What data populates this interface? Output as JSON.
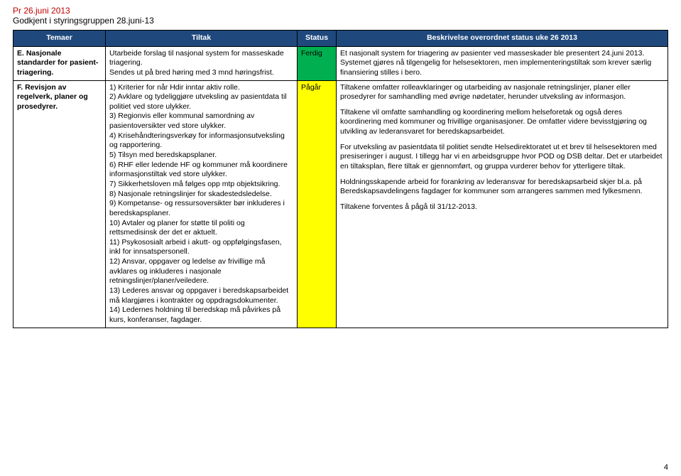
{
  "header": {
    "line1": "Pr 26.juni 2013",
    "line2": "Godkjent i styringsgruppen 28.juni-13"
  },
  "columns": {
    "temaer": "Temaer",
    "tiltak": "Tiltak",
    "status": "Status",
    "beskriv": "Beskrivelse overordnet status uke 26 2013"
  },
  "rows": [
    {
      "tema": "E. Nasjonale standarder for pasient-triagering.",
      "tiltak": "Utarbeide forslag til nasjonal system for masseskade triagering.\nSendes ut på bred høring med 3 mnd høringsfrist.",
      "status": "Ferdig",
      "status_class": "status-green",
      "beskriv_paras": [
        "Et nasjonalt system for triagering av pasienter ved masseskader ble presentert 24.juni 2013. Systemet gjøres nå tilgengelig for helsesektoren, men implementeringstiltak som krever særlig finansiering stilles i bero."
      ]
    },
    {
      "tema": "F. Revisjon av regelverk, planer og prosedyrer.",
      "tiltak": "1) Kriterier for når Hdir inntar aktiv rolle.\n2) Avklare og tydeliggjøre utveksling av pasientdata til politiet ved store ulykker.\n3) Regionvis eller kommunal samordning av pasientoversikter ved store ulykker.\n4) Krisehåndteringsverkøy for informasjonsutveksling og rapportering.\n5) Tilsyn med beredskapsplaner.\n6) RHF eller ledende HF og kommuner må koordinere informasjonstiltak ved store ulykker.\n7) Sikkerhetsloven må følges opp mtp objektsikring.\n8) Nasjonale retningslinjer for skadestedsledelse.\n9) Kompetanse- og ressursoversikter bør inkluderes i beredskapsplaner.\n10) Avtaler og planer for støtte til politi og rettsmedisinsk der det er aktuelt.\n11) Psykososialt arbeid i akutt- og oppfølgingsfasen, inkl for innsatspersonell.\n12) Ansvar, oppgaver og ledelse av frivillige må avklares og inkluderes i nasjonale retningslinjer/planer/veiledere.\n13) Lederes ansvar og oppgaver i beredskapsarbeidet må klargjøres i kontrakter og oppdragsdokumenter.\n14) Ledernes holdning til beredskap må påvirkes på kurs, konferanser, fagdager.",
      "status": "Pågår",
      "status_class": "status-yellow",
      "beskriv_paras": [
        "Tiltakene omfatter rolleavklaringer og utarbeiding av nasjonale retningslinjer, planer eller prosedyrer for samhandling med øvrige nødetater, herunder utveksling av informasjon.",
        "Tiltakene vil omfatte samhandling og koordinering mellom helseforetak og også deres koordinering med kommuner og frivillige organisasjoner. De omfatter videre bevisstgjøring og utvikling av lederansvaret for beredskapsarbeidet.",
        "For utveksling av pasientdata til politiet sendte Helsedirektoratet ut et brev til helsesektoren med presiseringer i august. I tillegg har vi en arbeidsgruppe hvor POD og DSB deltar. Det er utarbeidet en tiltaksplan, flere tiltak er gjennomført, og gruppa vurderer behov for ytterligere tiltak.",
        "Holdningsskapende arbeid for forankring av lederansvar for beredskapsarbeid skjer bl.a. på Beredskapsavdelingens fagdager for kommuner som arrangeres sammen med fylkesmenn.",
        "Tiltakene forventes å pågå til 31/12-2013."
      ]
    }
  ],
  "page_num": "4"
}
